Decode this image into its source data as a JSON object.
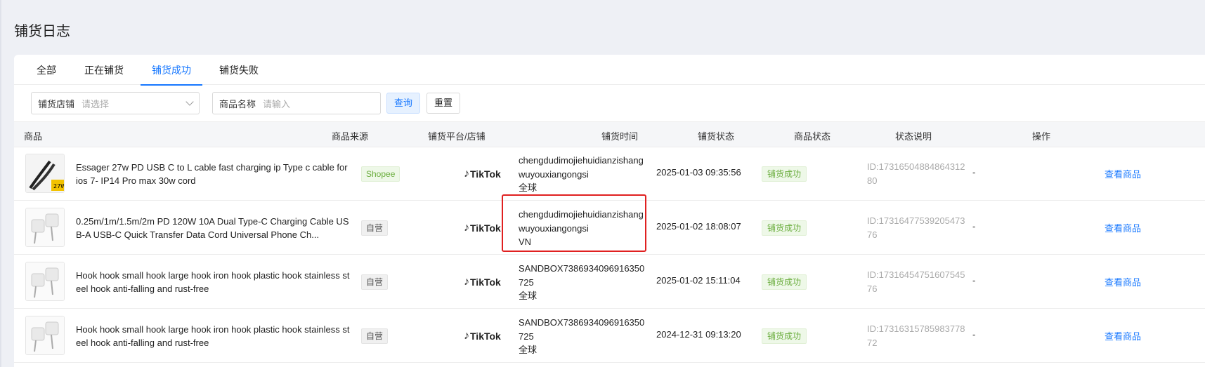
{
  "page": {
    "title": "铺货日志"
  },
  "tabs": [
    {
      "label": "全部"
    },
    {
      "label": "正在铺货"
    },
    {
      "label": "铺货成功",
      "active": true
    },
    {
      "label": "铺货失败"
    }
  ],
  "filters": {
    "shop_label": "铺货店铺",
    "shop_placeholder": "请选择",
    "name_label": "商品名称",
    "name_placeholder": "请输入",
    "query_button": "查询",
    "reset_button": "重置"
  },
  "table": {
    "headers": {
      "product": "商品",
      "source": "商品来源",
      "platform": "铺货平台/店铺",
      "time": "铺货时间",
      "status": "铺货状态",
      "product_status": "商品状态",
      "note": "状态说明",
      "action": "操作"
    },
    "rows": [
      {
        "name": "Essager 27w PD USB C to L cable fast charging ip Type c cable for ios 7- IP14 Pro max 30w cord",
        "source": "Shopee",
        "platform_logo": "TikTok",
        "shop": "chengdudimojiehuidianzishangwuyouxiangongsi",
        "region": "全球",
        "time": "2025-01-03 09:35:56",
        "status": "铺货成功",
        "product_id": "ID:1731650488486431280",
        "note": "-",
        "action": "查看商品"
      },
      {
        "name": "0.25m/1m/1.5m/2m PD 120W 10A Dual Type-C Charging Cable USB-A USB-C Quick Transfer Data Cord Universal Phone Ch...",
        "source": "自营",
        "platform_logo": "TikTok",
        "shop": "chengdudimojiehuidianzishangwuyouxiangongsi",
        "region": "VN",
        "time": "2025-01-02 18:08:07",
        "status": "铺货成功",
        "product_id": "ID:1731647753920547376",
        "note": "-",
        "action": "查看商品"
      },
      {
        "name": "Hook hook small hook large hook iron hook plastic hook stainless steel hook anti-falling and rust-free",
        "source": "自营",
        "platform_logo": "TikTok",
        "shop": "SANDBOX7386934096916350725",
        "region": "全球",
        "time": "2025-01-02 15:11:04",
        "status": "铺货成功",
        "product_id": "ID:1731645475160754576",
        "note": "-",
        "action": "查看商品"
      },
      {
        "name": "Hook hook small hook large hook iron hook plastic hook stainless steel hook anti-falling and rust-free",
        "source": "自营",
        "platform_logo": "TikTok",
        "shop": "SANDBOX7386934096916350725",
        "region": "全球",
        "time": "2024-12-31 09:13:20",
        "status": "铺货成功",
        "product_id": "ID:1731631578598377872",
        "note": "-",
        "action": "查看商品"
      }
    ]
  },
  "colors": {
    "accent": "#1677ff",
    "success": "#6cae3f",
    "highlight": "#e02020"
  }
}
